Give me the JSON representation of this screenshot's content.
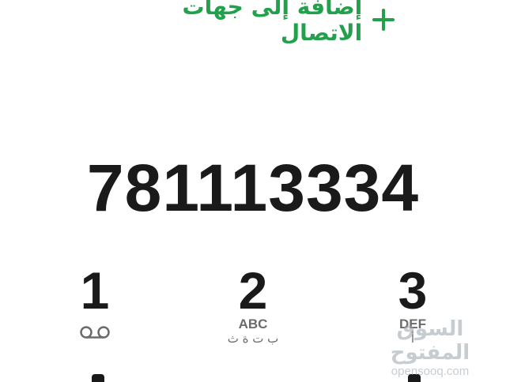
{
  "add_contact": {
    "label": "إضافة إلى جهات الاتصال",
    "icon": "plus-icon",
    "color": "#22a04b"
  },
  "dialed_number": "781113334",
  "keypad": {
    "keys": [
      {
        "digit": "1",
        "latin": "",
        "arabic": "",
        "icon": "voicemail-icon"
      },
      {
        "digit": "2",
        "latin": "ABC",
        "arabic": "ب ت ة ث"
      },
      {
        "digit": "3",
        "latin": "DEF",
        "arabic": "أ"
      }
    ]
  },
  "watermark": {
    "arabic": "السوق المفتوح",
    "latin": "opensooq.com"
  }
}
